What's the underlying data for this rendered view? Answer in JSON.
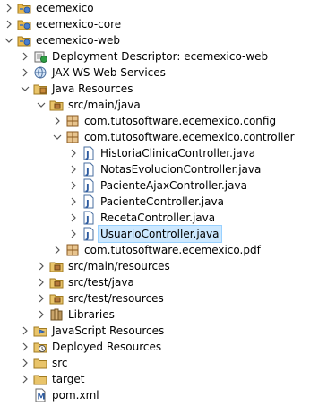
{
  "explorer": {
    "items": [
      {
        "label": "ecemexico",
        "icon": "project-icon",
        "twisty": "collapsed"
      },
      {
        "label": "ecemexico-core",
        "icon": "project-icon",
        "twisty": "collapsed"
      },
      {
        "label": "ecemexico-web",
        "icon": "project-icon",
        "twisty": "expanded"
      },
      {
        "label": "Deployment Descriptor: ecemexico-web",
        "icon": "deployment-descriptor-icon",
        "twisty": "collapsed"
      },
      {
        "label": "JAX-WS Web Services",
        "icon": "webservices-icon",
        "twisty": "collapsed"
      },
      {
        "label": "Java Resources",
        "icon": "java-resources-icon",
        "twisty": "expanded"
      },
      {
        "label": "src/main/java",
        "icon": "source-folder-icon",
        "twisty": "expanded"
      },
      {
        "label": "com.tutosoftware.ecemexico.config",
        "icon": "package-icon",
        "twisty": "collapsed"
      },
      {
        "label": "com.tutosoftware.ecemexico.controller",
        "icon": "package-icon",
        "twisty": "expanded"
      },
      {
        "label": "HistoriaClinicaController.java",
        "icon": "java-file-icon",
        "twisty": "collapsed"
      },
      {
        "label": "NotasEvolucionController.java",
        "icon": "java-file-icon",
        "twisty": "collapsed"
      },
      {
        "label": "PacienteAjaxController.java",
        "icon": "java-file-icon",
        "twisty": "collapsed"
      },
      {
        "label": "PacienteController.java",
        "icon": "java-file-icon",
        "twisty": "collapsed"
      },
      {
        "label": "RecetaController.java",
        "icon": "java-file-icon",
        "twisty": "collapsed"
      },
      {
        "label": "UsuarioController.java",
        "icon": "java-file-icon",
        "twisty": "collapsed",
        "selected": true
      },
      {
        "label": "com.tutosoftware.ecemexico.pdf",
        "icon": "package-icon",
        "twisty": "collapsed"
      },
      {
        "label": "src/main/resources",
        "icon": "source-folder-icon",
        "twisty": "collapsed"
      },
      {
        "label": "src/test/java",
        "icon": "source-folder-icon",
        "twisty": "collapsed"
      },
      {
        "label": "src/test/resources",
        "icon": "source-folder-icon",
        "twisty": "collapsed"
      },
      {
        "label": "Libraries",
        "icon": "libraries-icon",
        "twisty": "collapsed"
      },
      {
        "label": "JavaScript Resources",
        "icon": "javascript-resources-icon",
        "twisty": "collapsed"
      },
      {
        "label": "Deployed Resources",
        "icon": "deployed-resources-icon",
        "twisty": "collapsed"
      },
      {
        "label": "src",
        "icon": "folder-icon",
        "twisty": "collapsed"
      },
      {
        "label": "target",
        "icon": "folder-icon",
        "twisty": "collapsed"
      },
      {
        "label": "pom.xml",
        "icon": "xml-file-icon",
        "twisty": "none"
      }
    ]
  }
}
